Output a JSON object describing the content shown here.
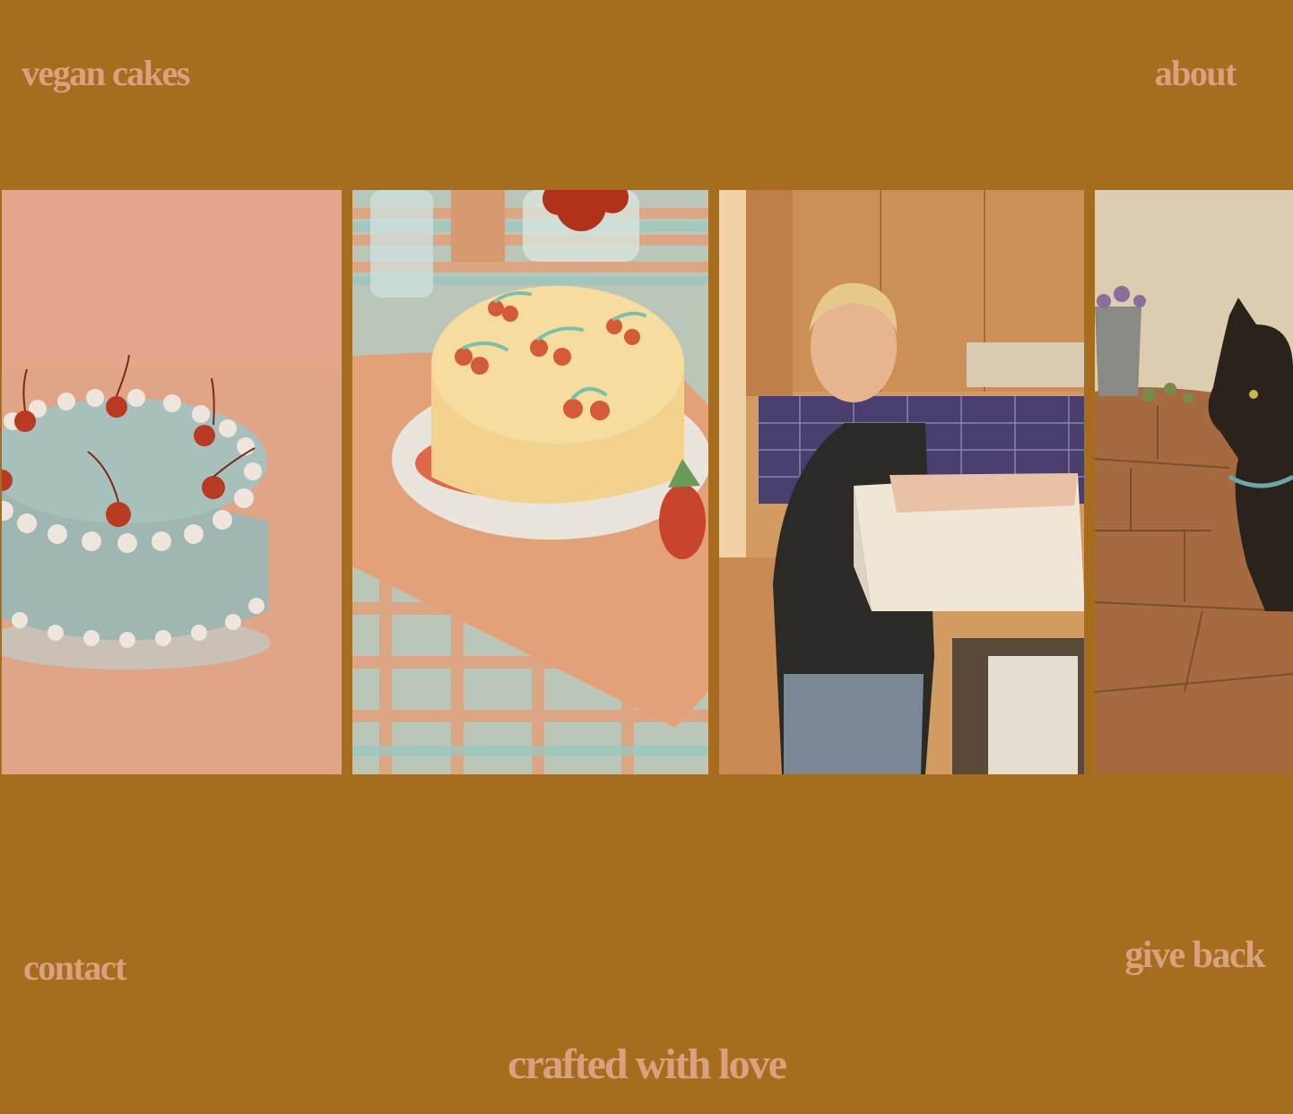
{
  "nav": {
    "vegan_cakes": "vegan cakes",
    "about": "about",
    "contact": "contact",
    "give_back": "give back"
  },
  "tagline": "crafted with love",
  "gallery": [
    {
      "icon": "cherry-cake-photo"
    },
    {
      "icon": "cherry-piped-cake-photo"
    },
    {
      "icon": "baker-with-box-photo"
    },
    {
      "icon": "black-cat-photo"
    }
  ],
  "colors": {
    "background": "#a66d1f",
    "text": "#d9a17e"
  }
}
